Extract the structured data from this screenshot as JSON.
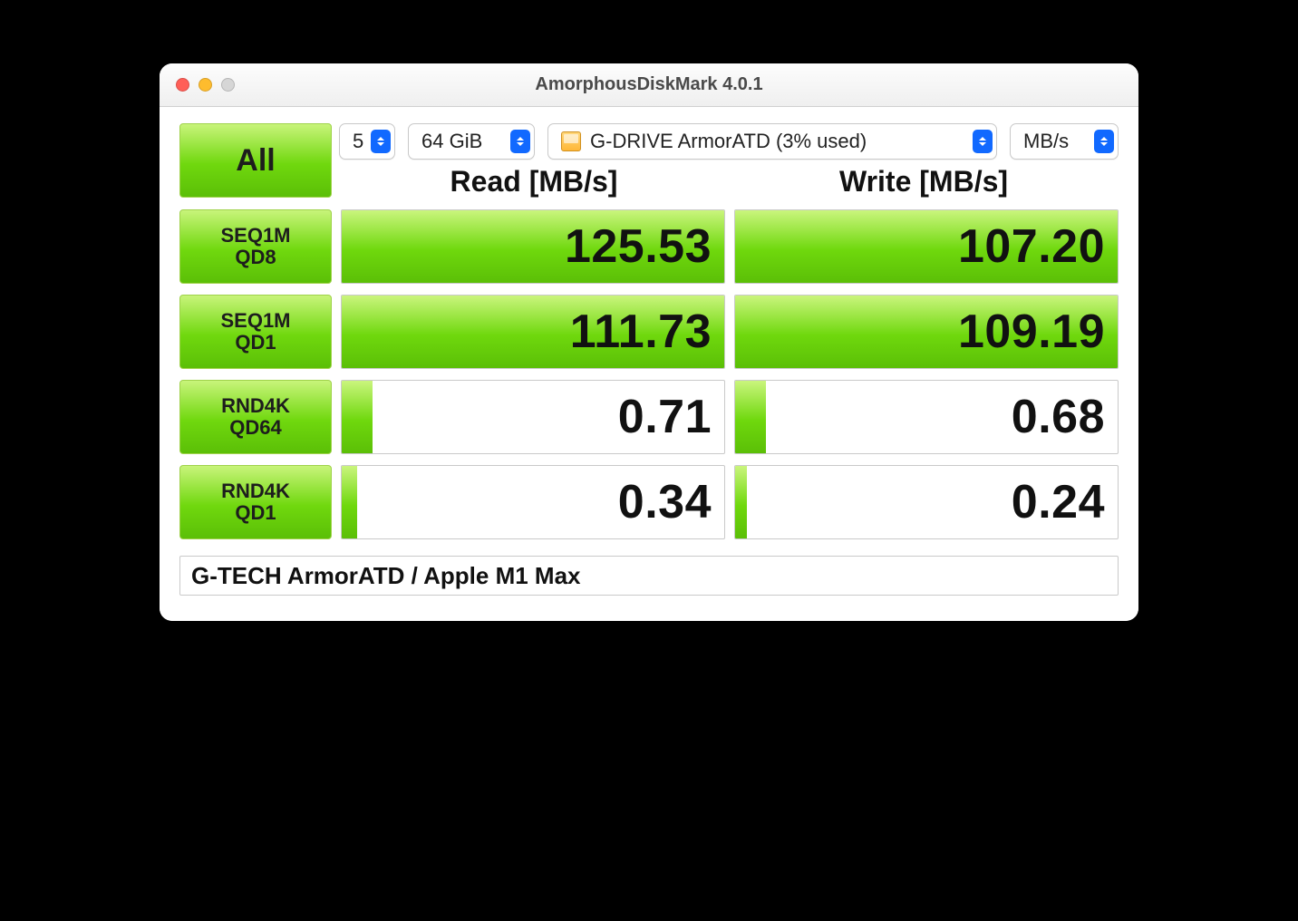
{
  "window": {
    "title": "AmorphousDiskMark 4.0.1"
  },
  "toolbar": {
    "all_label": "All",
    "runs": "5",
    "size": "64 GiB",
    "drive": "G-DRIVE ArmorATD (3% used)",
    "unit": "MB/s"
  },
  "headers": {
    "read": "Read [MB/s]",
    "write": "Write [MB/s]"
  },
  "tests": [
    {
      "label_line1": "SEQ1M",
      "label_line2": "QD8",
      "read": "125.53",
      "write": "107.20",
      "read_bar": 100,
      "write_bar": 100
    },
    {
      "label_line1": "SEQ1M",
      "label_line2": "QD1",
      "read": "111.73",
      "write": "109.19",
      "read_bar": 100,
      "write_bar": 100
    },
    {
      "label_line1": "RND4K",
      "label_line2": "QD64",
      "read": "0.71",
      "write": "0.68",
      "read_bar": 8,
      "write_bar": 8
    },
    {
      "label_line1": "RND4K",
      "label_line2": "QD1",
      "read": "0.34",
      "write": "0.24",
      "read_bar": 4,
      "write_bar": 3
    }
  ],
  "footer": {
    "text": "G-TECH ArmorATD / Apple M1 Max"
  }
}
